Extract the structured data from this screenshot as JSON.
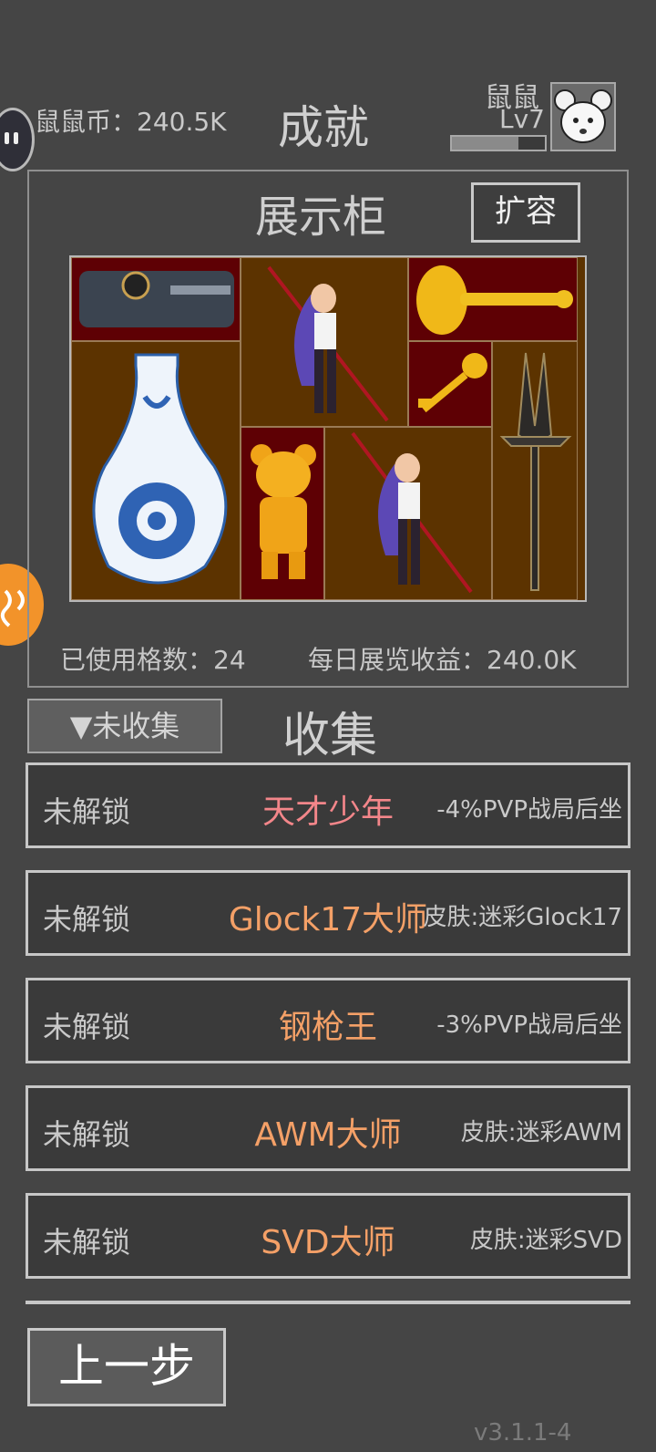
{
  "header": {
    "coins": "鼠鼠币：240.5K",
    "title": "成就",
    "player_name": "鼠鼠",
    "player_level": "Lv7",
    "xp_progress": 0.72
  },
  "cabinet": {
    "title": "展示柜",
    "expand_label": "扩容",
    "items": [
      {
        "name": "pistol-slide-icon"
      },
      {
        "name": "spear-heroine-figure-icon"
      },
      {
        "name": "golden-key-large-icon"
      },
      {
        "name": "blue-white-vase-icon"
      },
      {
        "name": "golden-key-small-icon"
      },
      {
        "name": "dark-dagger-icon"
      },
      {
        "name": "golden-bear-figure-icon"
      },
      {
        "name": "spear-heroine-figure-2-icon"
      }
    ],
    "used_slots": "已使用格数：24",
    "daily_income": "每日展览收益：240.0K"
  },
  "collection": {
    "filter_label": "▼未收集",
    "title": "收集",
    "rows": [
      {
        "status": "未解锁",
        "name": "天才少年",
        "reward": "-4%PVP战局后坐",
        "color": "pink"
      },
      {
        "status": "未解锁",
        "name": "Glock17大师",
        "reward": "皮肤:迷彩Glock17",
        "color": "orange"
      },
      {
        "status": "未解锁",
        "name": "钢枪王",
        "reward": "-3%PVP战局后坐",
        "color": "orange"
      },
      {
        "status": "未解锁",
        "name": "AWM大师",
        "reward": "皮肤:迷彩AWM",
        "color": "orange"
      },
      {
        "status": "未解锁",
        "name": "SVD大师",
        "reward": "皮肤:迷彩SVD",
        "color": "orange"
      }
    ]
  },
  "footer": {
    "back_label": "上一步",
    "version": "v3.1.1-4"
  }
}
